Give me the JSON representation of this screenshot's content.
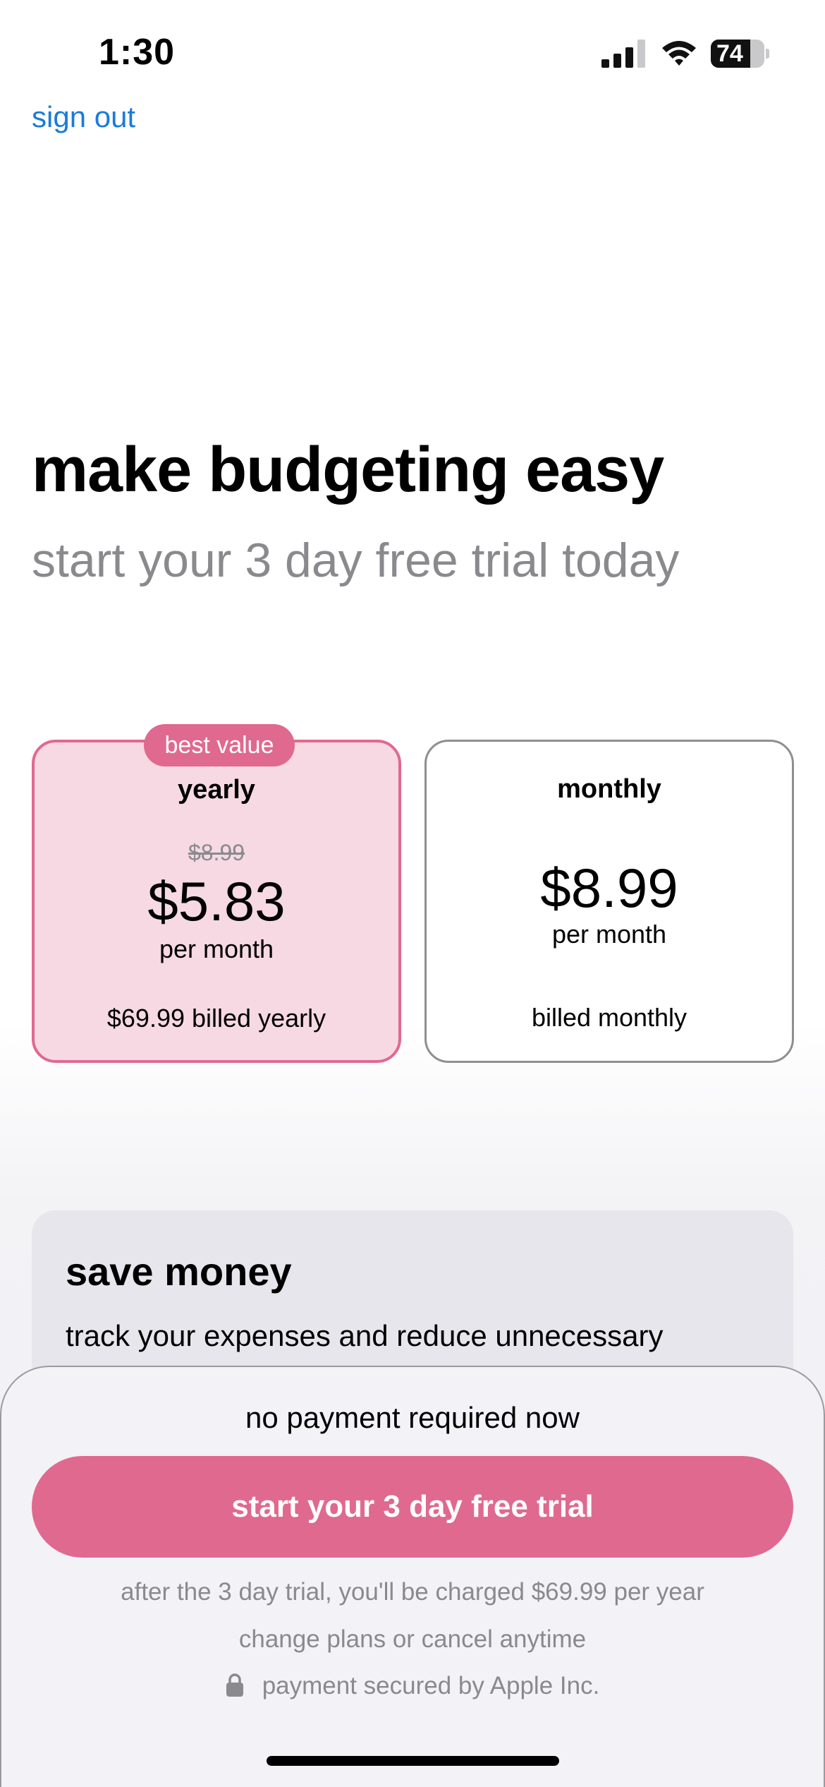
{
  "status_bar": {
    "time": "1:30",
    "battery_level": "74",
    "battery_fraction": 0.74,
    "signal_icon": "cellular-signal-icon",
    "wifi_icon": "wifi-icon",
    "battery_icon": "battery-icon"
  },
  "header": {
    "sign_out_label": "sign out"
  },
  "hero": {
    "title": "make budgeting easy",
    "subtitle": "start your 3 day free trial today"
  },
  "plans": [
    {
      "badge": "best value",
      "name": "yearly",
      "old_price": "$8.99",
      "price": "$5.83",
      "period": "per month",
      "billing": "$69.99 billed yearly",
      "selected": true
    },
    {
      "name": "monthly",
      "price": "$8.99",
      "period": "per month",
      "billing": "billed monthly",
      "selected": false
    }
  ],
  "feature": {
    "title": "save money",
    "text": "track your expenses and reduce unnecessary"
  },
  "bottom_sheet": {
    "no_payment": "no payment required now",
    "cta_label": "start your 3 day free trial",
    "charge_note": "after the 3 day trial, you'll be charged $69.99 per year",
    "cancel_note": "change plans or cancel anytime",
    "secure_note": "payment secured by Apple Inc.",
    "lock_icon": "lock-icon"
  },
  "colors": {
    "accent": "#e0698f",
    "accent_light": "#f6d9e2",
    "link": "#1a7bdb",
    "secondary_text": "#8a8a8e"
  }
}
